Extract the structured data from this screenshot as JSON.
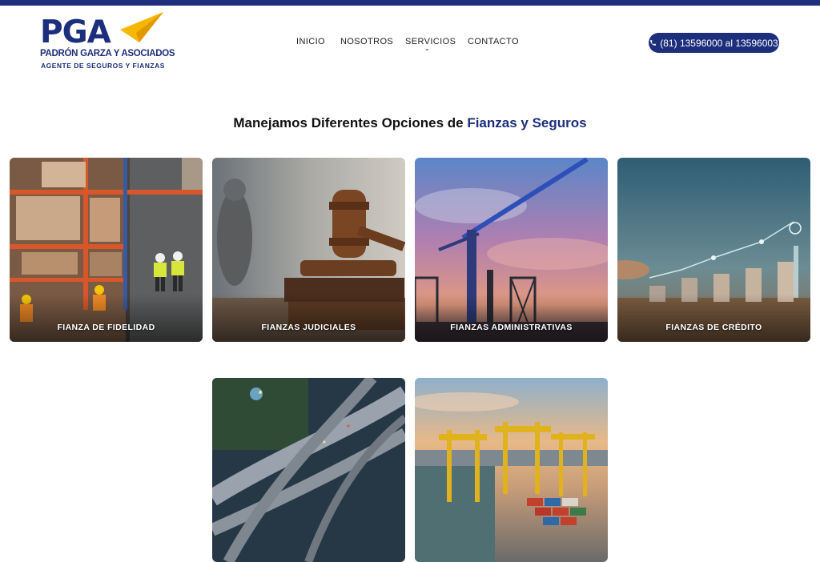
{
  "header": {
    "logo": {
      "mark": "PGA",
      "line1": "PADRÓN GARZA Y ASOCIADOS",
      "line2": "AGENTE DE SEGUROS Y FIANZAS"
    },
    "nav": [
      "INICIO",
      "NOSOTROS",
      "SERVICIOS",
      "CONTACTO"
    ],
    "phone": "(81) 13596000 al 13596003"
  },
  "section": {
    "title_prefix": "Manejamos Diferentes Opciones de",
    "title_accent": "Fianzas y Seguros"
  },
  "cards": [
    {
      "label": "FIANZA DE FIDELIDAD",
      "image": "warehouse-photo"
    },
    {
      "label": "FIANZAS JUDICIALES",
      "image": "gavel-photo"
    },
    {
      "label": "FIANZAS ADMINISTRATIVAS",
      "image": "crane-photo"
    },
    {
      "label": "FIANZAS DE CRÉDITO",
      "image": "coins-chart-photo"
    },
    {
      "label": "",
      "image": "highway-photo"
    },
    {
      "label": "",
      "image": "port-cranes-photo"
    }
  ],
  "colors": {
    "brand_navy": "#1d2f7c",
    "brand_gold": "#f5b700"
  }
}
